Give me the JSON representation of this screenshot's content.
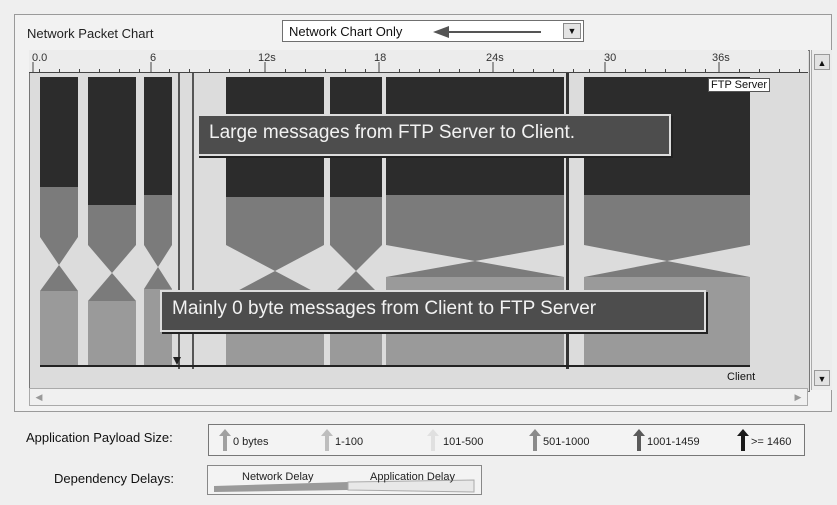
{
  "panel": {
    "title": "Network Packet Chart"
  },
  "view_select": {
    "value": "Network Chart Only"
  },
  "ruler": {
    "ticks": [
      "0.0",
      "6",
      "12s",
      "18",
      "24s",
      "30",
      "36s"
    ]
  },
  "nodes": {
    "top": "FTP Server",
    "bottom": "Client"
  },
  "callouts": {
    "top": "Large messages from FTP Server to Client.",
    "bottom": "Mainly 0 byte messages from Client to FTP Server"
  },
  "payload_legend": {
    "label": "Application Payload Size:",
    "items": [
      {
        "label": "0 bytes",
        "color": "#a0a0a0"
      },
      {
        "label": "1-100",
        "color": "#bdbdbd"
      },
      {
        "label": "101-500",
        "color": "#e0e0e0"
      },
      {
        "label": "501-1000",
        "color": "#8a8a8a"
      },
      {
        "label": "1001-1459",
        "color": "#5a5a5a"
      },
      {
        "label": ">= 1460",
        "color": "#1a1a1a"
      }
    ]
  },
  "delay_legend": {
    "label": "Dependency Delays:",
    "network": "Network Delay",
    "application": "Application Delay"
  },
  "colors": {
    "dark": "#2c2c2c",
    "mid": "#7b7b7b",
    "light": "#9a9a9a",
    "background": "#dcdcdc"
  }
}
